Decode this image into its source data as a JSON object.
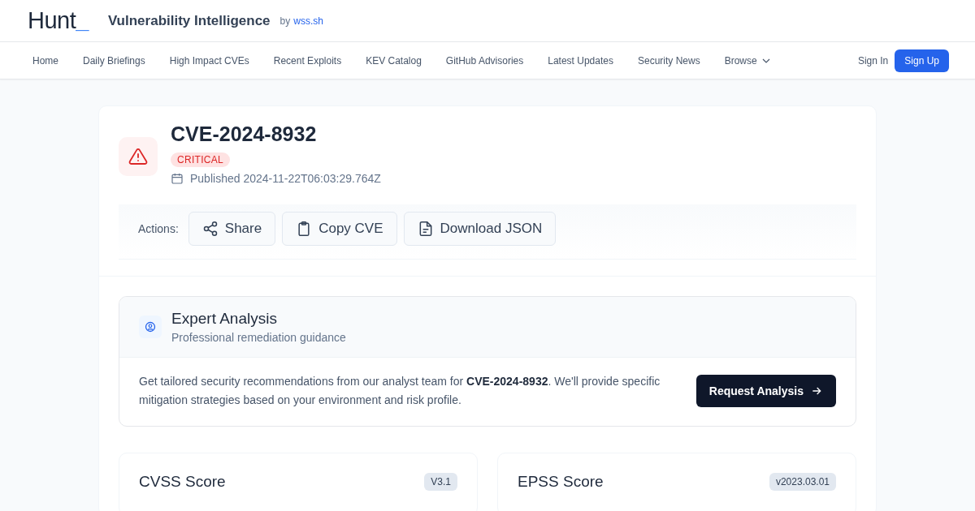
{
  "header": {
    "logo": {
      "text": "Hunt",
      "cursor": "_"
    },
    "title": "Vulnerability Intelligence",
    "by": "by",
    "by_link": "wss.sh"
  },
  "nav": {
    "items": [
      {
        "label": "Home",
        "dropdown": false
      },
      {
        "label": "Daily Briefings",
        "dropdown": false
      },
      {
        "label": "High Impact CVEs",
        "dropdown": false
      },
      {
        "label": "Recent Exploits",
        "dropdown": false
      },
      {
        "label": "KEV Catalog",
        "dropdown": false
      },
      {
        "label": "GitHub Advisories",
        "dropdown": false
      },
      {
        "label": "Latest Updates",
        "dropdown": false
      },
      {
        "label": "Security News",
        "dropdown": false
      },
      {
        "label": "Browse",
        "dropdown": true
      }
    ],
    "sign_in": "Sign In",
    "sign_up": "Sign Up"
  },
  "cve": {
    "id": "CVE-2024-8932",
    "severity": {
      "label": "CRITICAL",
      "kind": "critical"
    },
    "published": "Published 2024-11-22T06:03:29.764Z"
  },
  "actions": {
    "label": "Actions:",
    "buttons": [
      {
        "label": "Share",
        "kind": "share"
      },
      {
        "label": "Copy CVE",
        "kind": "copy"
      },
      {
        "label": "Download JSON",
        "kind": "download"
      }
    ]
  },
  "expert": {
    "title": "Expert Analysis",
    "subtitle": "Professional remediation guidance",
    "text": "Get tailored security recommendations from our analyst team for **CVE-2024-8932**. We'll provide specific mitigation strategies based on your environment and risk profile.",
    "button": "Request Analysis"
  },
  "scores": [
    {
      "title": "CVSS Score",
      "version": "V3.1"
    },
    {
      "title": "EPSS Score",
      "version": "v2023.03.01"
    }
  ]
}
